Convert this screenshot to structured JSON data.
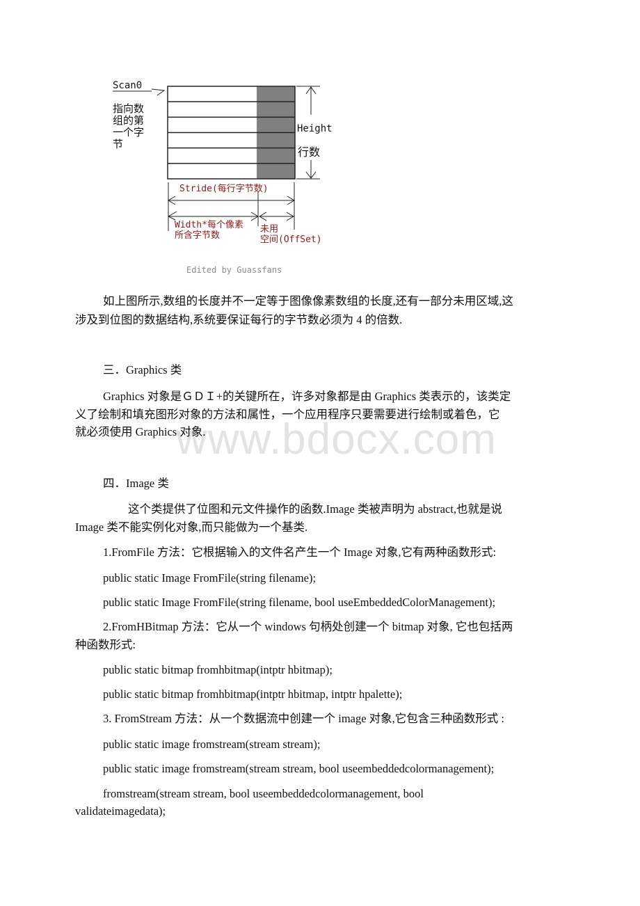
{
  "diagram": {
    "scan0_label": "Scan0",
    "scan0_desc_lines": [
      "指向数",
      "组的第",
      "一个字",
      "节"
    ],
    "height_label": "Height",
    "rows_label": "行数",
    "stride_label": "Stride(每行字节数)",
    "width_label_lines": [
      "Width*每个像素",
      "所含字节数"
    ],
    "unused_label_lines": [
      "未用",
      "空间(OffSet)"
    ],
    "credit": "Edited by Guassfans",
    "row_count": 6,
    "colors": {
      "grid_line": "#222222",
      "unused_fill": "#808080",
      "annotation": "#8b1a1a"
    }
  },
  "paragraphs": {
    "intro_line1": "如上图所示,数组的长度并不一定等于图像像素数组的长度,还有一部分未用区域,这",
    "intro_line2": "涉及到位图的数据结构,系统要保证每行的字节数必须为 4 的倍数."
  },
  "section3": {
    "heading": "三．Graphics 类",
    "line1": "Graphics 对象是ＧＤＩ+的关键所在，许多对象都是由 Graphics 类表示的，该类定",
    "line2": "义了绘制和填充图形对象的方法和属性，一个应用程序只要需要进行绘制或着色，它",
    "line3": "就必须使用 Graphics 对象."
  },
  "watermark": "www.bdocx.com",
  "section4": {
    "heading": "四．Image 类",
    "intro_line1": "这个类提供了位图和元文件操作的函数.Image 类被声明为 abstract,也就是说",
    "intro_line2": "Image 类不能实例化对象,而只能做为一个基类.",
    "fromfile_desc": "1.FromFile 方法：它根据输入的文件名产生一个 Image 对象,它有两种函数形式:",
    "fromfile_sig1": "public static Image FromFile(string filename);",
    "fromfile_sig2": "public static Image FromFile(string filename, bool useEmbeddedColorManagement);",
    "fromhbitmap_desc_line1": "2.FromHBitmap 方法：它从一个 windows 句柄处创建一个 bitmap 对象, 它也包括两",
    "fromhbitmap_desc_line2": "种函数形式:",
    "fromhbitmap_sig1": "public static bitmap fromhbitmap(intptr hbitmap);",
    "fromhbitmap_sig2": "public static bitmap fromhbitmap(intptr hbitmap, intptr hpalette);",
    "fromstream_desc": "3. FromStream 方法：从一个数据流中创建一个 image 对象,它包含三种函数形式 :",
    "fromstream_sig1": "public static image fromstream(stream stream);",
    "fromstream_sig2": "public static image fromstream(stream stream, bool useembeddedcolormanagement);",
    "fromstream_sig3_line1": "fromstream(stream stream, bool useembeddedcolormanagement, bool",
    "fromstream_sig3_line2": "validateimagedata);"
  }
}
